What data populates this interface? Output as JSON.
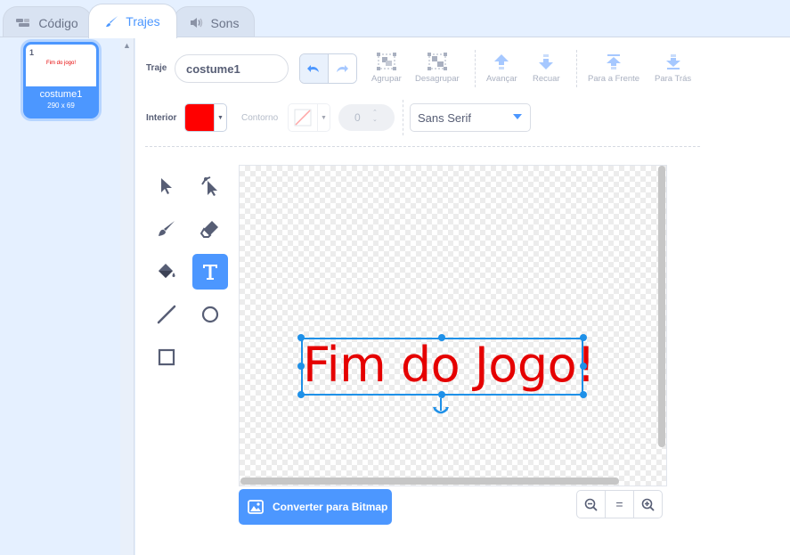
{
  "tabs": [
    {
      "label": "Código",
      "icon": "code-blocks-icon"
    },
    {
      "label": "Trajes",
      "icon": "paintbrush-icon"
    },
    {
      "label": "Sons",
      "icon": "speaker-icon"
    }
  ],
  "costume_list": {
    "items": [
      {
        "number": "1",
        "name": "costume1",
        "size": "290 x 69",
        "preview_text": "Fim do jogo!"
      }
    ]
  },
  "toolbar": {
    "costume_label": "Traje",
    "costume_name": "costume1",
    "group_label": "Agrupar",
    "ungroup_label": "Desagrupar",
    "forward_label": "Avançar",
    "backward_label": "Recuar",
    "front_label": "Para a Frente",
    "back_label": "Para Trás",
    "fill_label": "Interior",
    "fill_color": "#ff0000",
    "outline_label": "Contorno",
    "stroke_width": "0",
    "font": "Sans Serif"
  },
  "canvas": {
    "text": "Fim do Jogo!",
    "text_color": "#e50000"
  },
  "bottom": {
    "convert_label": "Converter para Bitmap",
    "zoom_reset": "="
  },
  "colors": {
    "accent": "#4c97ff",
    "selection": "#1e90e8"
  }
}
